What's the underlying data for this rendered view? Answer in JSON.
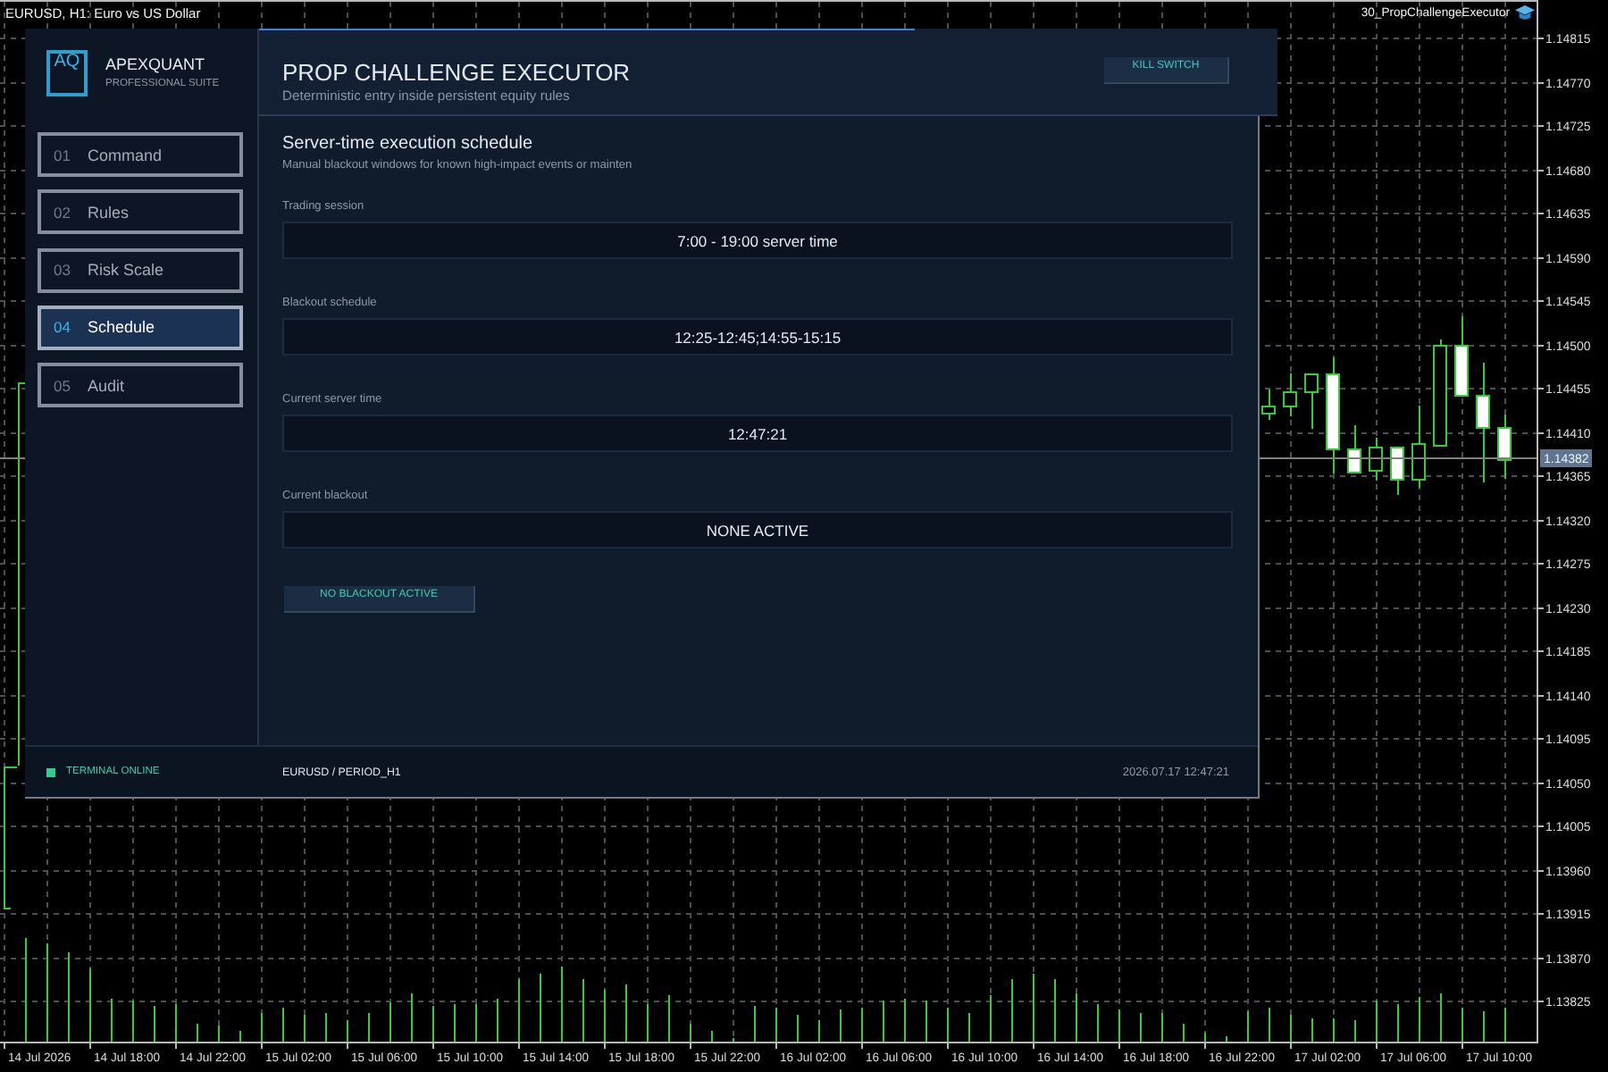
{
  "chart": {
    "caption": "EURUSD, H1: Euro vs US Dollar",
    "expert_name": "30_PropChallengeExecutor",
    "price_labels": [
      "1.14815",
      "1.14770",
      "1.14725",
      "1.14680",
      "1.14635",
      "1.14590",
      "1.14545",
      "1.14500",
      "1.14455",
      "1.14410",
      "1.14365",
      "1.14320",
      "1.14275",
      "1.14230",
      "1.14185",
      "1.14140",
      "1.14095",
      "1.14050",
      "1.14005",
      "1.13960",
      "1.13915",
      "1.13870",
      "1.13825"
    ],
    "current_price": "1.14382",
    "time_labels": [
      "14 Jul 2026",
      "14 Jul 18:00",
      "14 Jul 22:00",
      "15 Jul 02:00",
      "15 Jul 06:00",
      "15 Jul 10:00",
      "15 Jul 14:00",
      "15 Jul 18:00",
      "15 Jul 22:00",
      "16 Jul 02:00",
      "16 Jul 06:00",
      "16 Jul 10:00",
      "16 Jul 14:00",
      "16 Jul 18:00",
      "16 Jul 22:00",
      "17 Jul 02:00",
      "17 Jul 06:00",
      "17 Jul 10:00"
    ]
  },
  "app": {
    "brand": {
      "logo": "AQ",
      "name": "APEXQUANT",
      "tagline": "PROFESSIONAL SUITE"
    },
    "nav": [
      {
        "number": "01",
        "label": "Command",
        "selected": false
      },
      {
        "number": "02",
        "label": "Rules",
        "selected": false
      },
      {
        "number": "03",
        "label": "Risk Scale",
        "selected": false
      },
      {
        "number": "04",
        "label": "Schedule",
        "selected": true
      },
      {
        "number": "05",
        "label": "Audit",
        "selected": false
      }
    ],
    "header": {
      "title": "PROP CHALLENGE EXECUTOR",
      "subtitle": "Deterministic entry inside persistent equity rules",
      "kill_switch": "KILL SWITCH"
    },
    "section": {
      "title": "Server-time execution schedule",
      "description": "Manual blackout windows for known high-impact events or mainten"
    },
    "fields": [
      {
        "label": "Trading session",
        "value": "7:00 - 19:00 server time"
      },
      {
        "label": "Blackout schedule",
        "value": "12:25-12:45;14:55-15:15"
      },
      {
        "label": "Current server time",
        "value": "12:47:21"
      },
      {
        "label": "Current blackout",
        "value": "NONE ACTIVE"
      }
    ],
    "blackout_status": "NO BLACKOUT ACTIVE",
    "status_bar": {
      "online": true,
      "connection": "TERMINAL ONLINE",
      "symbol": "EURUSD / PERIOD_H1",
      "timestamp": "2026.07.17 12:47:21"
    }
  }
}
